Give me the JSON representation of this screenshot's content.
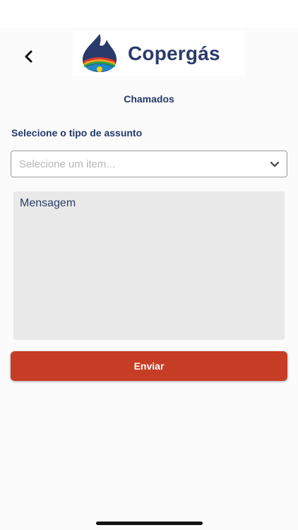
{
  "header": {
    "back_icon": "chevron-left-icon",
    "logo_text": "Copergás",
    "logo_colors": {
      "drop": "#2a3a6b",
      "red": "#e23b2e",
      "orange": "#f5a623",
      "yellow": "#f7d117",
      "green": "#2aa34a",
      "blue": "#1e88c8"
    }
  },
  "page": {
    "title": "Chamados"
  },
  "form": {
    "subject_label": "Selecione o tipo de assunto",
    "subject_select": {
      "placeholder": "Selecione um item...",
      "icon": "chevron-down-icon"
    },
    "message_placeholder": "Mensagem",
    "submit_label": "Enviar"
  },
  "colors": {
    "primary_text": "#22386a",
    "accent": "#c63d26",
    "background": "#fbfbfb"
  }
}
